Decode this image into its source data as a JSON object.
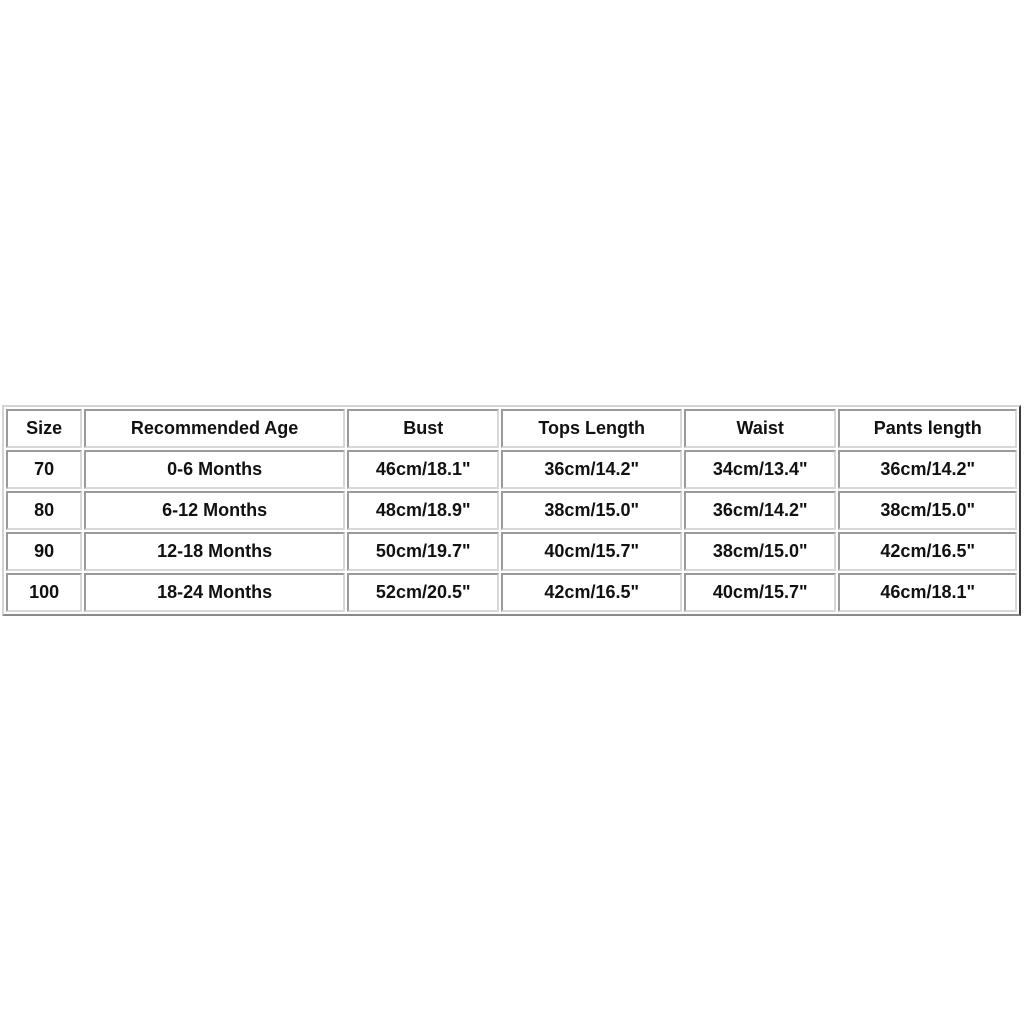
{
  "size_chart": {
    "headers": [
      "Size",
      "Recommended Age",
      "Bust",
      "Tops Length",
      "Waist",
      "Pants length"
    ],
    "rows": [
      [
        "70",
        "0-6 Months",
        "46cm/18.1\"",
        "36cm/14.2\"",
        "34cm/13.4\"",
        "36cm/14.2\""
      ],
      [
        "80",
        "6-12 Months",
        "48cm/18.9\"",
        "38cm/15.0\"",
        "36cm/14.2\"",
        "38cm/15.0\""
      ],
      [
        "90",
        "12-18 Months",
        "50cm/19.7\"",
        "40cm/15.7\"",
        "38cm/15.0\"",
        "42cm/16.5\""
      ],
      [
        "100",
        "18-24 Months",
        "52cm/20.5\"",
        "42cm/16.5\"",
        "40cm/15.7\"",
        "46cm/18.1\""
      ]
    ]
  }
}
